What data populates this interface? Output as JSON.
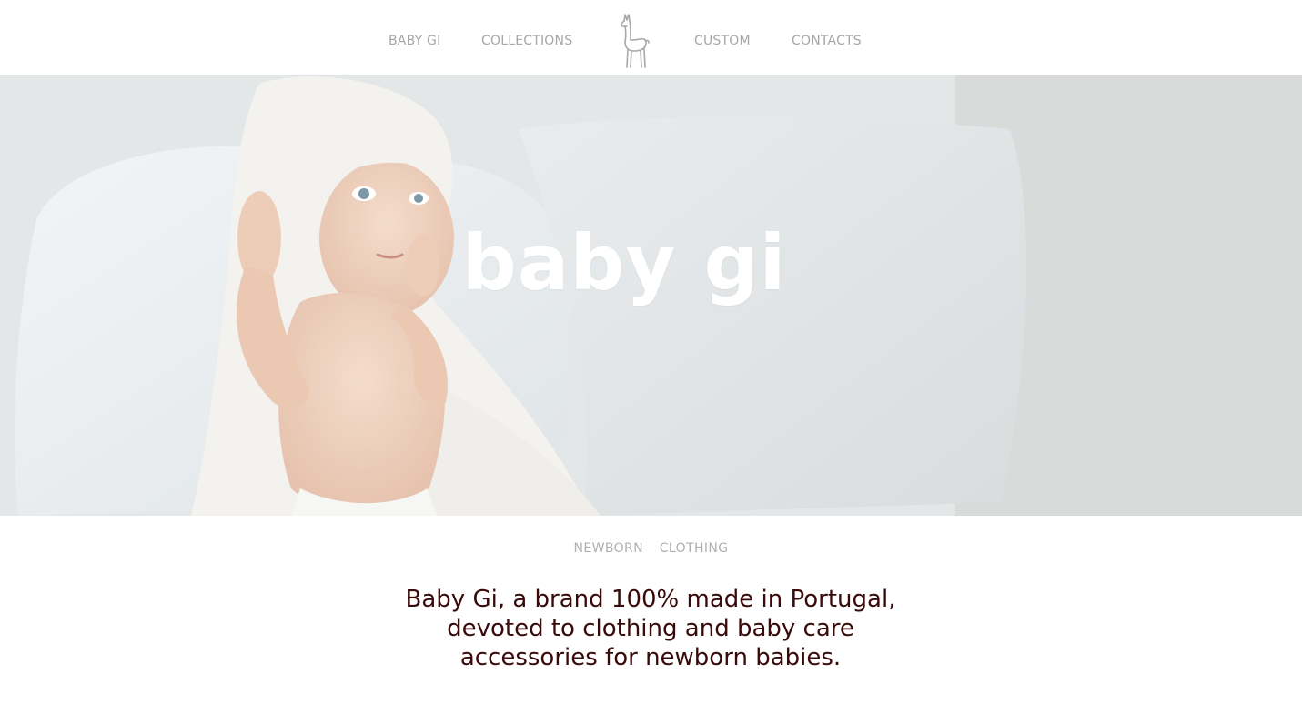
{
  "nav": {
    "items": [
      {
        "label": "BABY GI"
      },
      {
        "label": "COLLECTIONS"
      },
      {
        "label": "CUSTOM"
      },
      {
        "label": "CONTACTS"
      }
    ],
    "logo_icon": "llama-icon"
  },
  "hero": {
    "title": "baby gi",
    "image": "baby-in-hooded-towel-photo"
  },
  "section": {
    "subtitle": "NEWBORN  CLOTHING",
    "intro_lines": [
      "Baby Gi, a brand 100% made in Portugal,",
      "devoted to clothing and baby care",
      "accessories for newborn babies."
    ]
  },
  "colors": {
    "nav_text": "#a6a6a6",
    "intro_text": "#3a0a0a",
    "hero_title": "#ffffff"
  }
}
